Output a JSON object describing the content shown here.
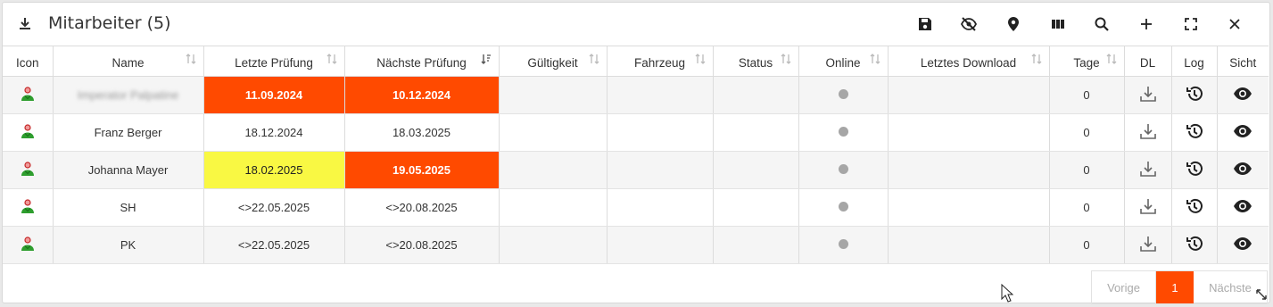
{
  "header": {
    "title": "Mitarbeiter (5)"
  },
  "toolbar": [
    "save-icon",
    "hide-icon",
    "location-icon",
    "columns-icon",
    "search-icon",
    "add-icon",
    "fullscreen-icon",
    "close-icon"
  ],
  "columns": [
    "Icon",
    "Name",
    "Letzte Prüfung",
    "Nächste Prüfung",
    "Gültigkeit",
    "Fahrzeug",
    "Status",
    "Online",
    "Letztes Download",
    "Tage",
    "DL",
    "Log",
    "Sicht"
  ],
  "rows": [
    {
      "name": "Imperator Palpatine",
      "last_check": "11.09.2024",
      "next_check": "10.12.2024",
      "days": "0"
    },
    {
      "name": "Franz Berger",
      "last_check": "18.12.2024",
      "next_check": "18.03.2025",
      "days": "0"
    },
    {
      "name": "Johanna Mayer",
      "last_check": "18.02.2025",
      "next_check": "19.05.2025",
      "days": "0"
    },
    {
      "name": "SH",
      "last_check": "<>22.05.2025",
      "next_check": "<>20.08.2025",
      "days": "0"
    },
    {
      "name": "PK",
      "last_check": "<>22.05.2025",
      "next_check": "<>20.08.2025",
      "days": "0"
    }
  ],
  "pager": {
    "prev": "Vorige",
    "current": "1",
    "next": "Nächste"
  },
  "colors": {
    "accent": "#ff4a00",
    "warning": "#f9f843",
    "offline": "#a6a6a6",
    "user_green": "#2e9e2e",
    "user_red": "#c62828"
  }
}
